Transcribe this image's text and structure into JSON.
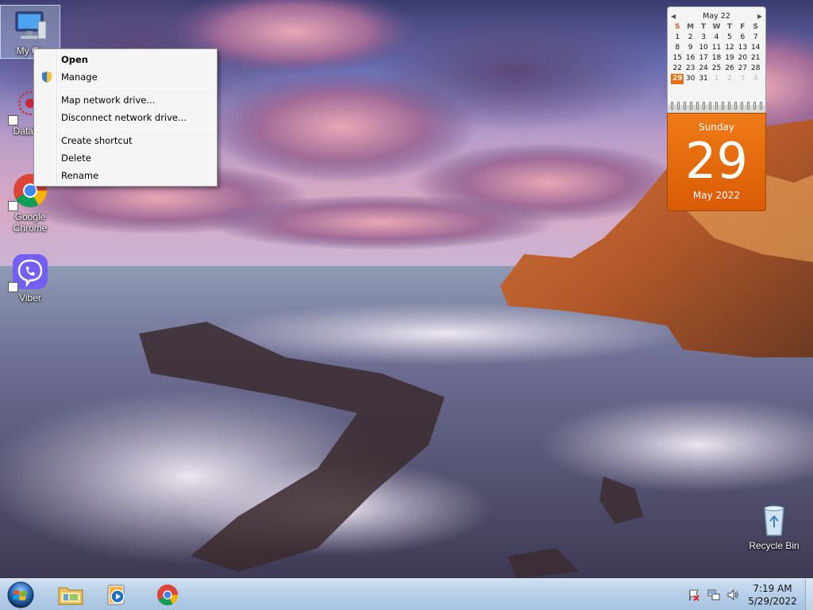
{
  "desktop": {
    "icons": [
      {
        "name": "my-computer",
        "label": "My Computer",
        "visible_label": "My Co"
      },
      {
        "name": "datawatch",
        "label": "DataWa"
      },
      {
        "name": "google-chrome",
        "label": "Google\nChrome",
        "line1": "Google",
        "line2": "Chrome"
      },
      {
        "name": "viber",
        "label": "Viber"
      },
      {
        "name": "recycle-bin",
        "label": "Recycle Bin"
      }
    ]
  },
  "context_menu": {
    "items": [
      {
        "label": "Open",
        "bold": true
      },
      {
        "label": "Manage",
        "icon": "uac-shield-icon"
      },
      {
        "separator": true
      },
      {
        "label": "Map network drive..."
      },
      {
        "label": "Disconnect network drive..."
      },
      {
        "separator": true
      },
      {
        "label": "Create shortcut"
      },
      {
        "label": "Delete"
      },
      {
        "label": "Rename"
      }
    ]
  },
  "calendar_gadget": {
    "month_title": "May 22",
    "weekdays": [
      "S",
      "M",
      "T",
      "W",
      "T",
      "F",
      "S"
    ],
    "weeks": [
      [
        "1",
        "2",
        "3",
        "4",
        "5",
        "6",
        "7"
      ],
      [
        "8",
        "9",
        "10",
        "11",
        "12",
        "13",
        "14"
      ],
      [
        "15",
        "16",
        "17",
        "18",
        "19",
        "20",
        "21"
      ],
      [
        "22",
        "23",
        "24",
        "25",
        "26",
        "27",
        "28"
      ],
      [
        "29",
        "30",
        "31",
        "1",
        "2",
        "3",
        "4"
      ]
    ],
    "today": "29",
    "weekday_name": "Sunday",
    "day_number": "29",
    "month_year": "May 2022",
    "accent_color": "#e86f10"
  },
  "taskbar": {
    "start_icon": "windows-orb-icon",
    "pinned": [
      {
        "name": "file-explorer",
        "icon": "folder-icon"
      },
      {
        "name": "media-player",
        "icon": "media-player-icon"
      },
      {
        "name": "google-chrome",
        "icon": "chrome-icon"
      }
    ],
    "tray_icons": [
      "action-center-flag-icon",
      "network-icon",
      "volume-icon"
    ],
    "time": "7:19 AM",
    "date": "5/29/2022"
  }
}
